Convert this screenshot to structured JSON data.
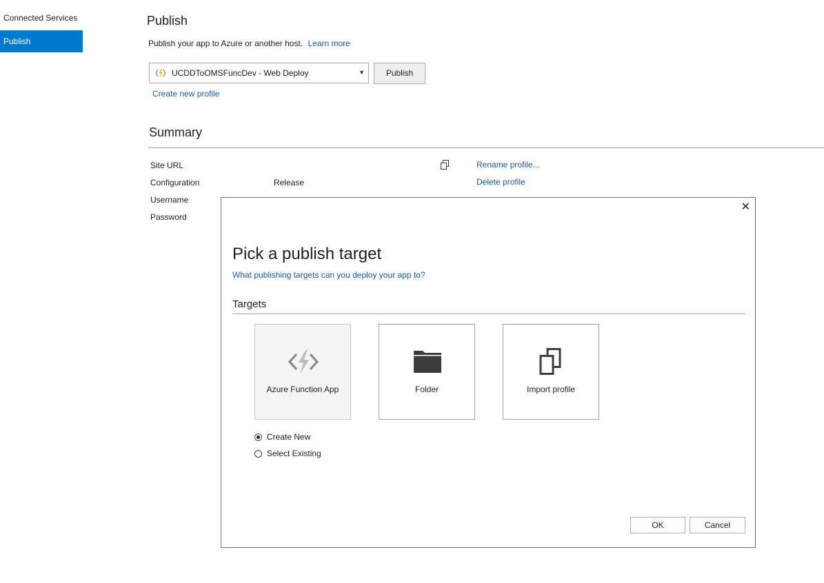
{
  "nav": {
    "items": [
      {
        "label": "Connected Services"
      },
      {
        "label": "Publish"
      }
    ]
  },
  "header": {
    "title": "Publish",
    "description": "Publish your app to Azure or another host.",
    "learn_more": "Learn more"
  },
  "profile": {
    "selected": "UCDDToOMSFuncDev - Web Deploy",
    "publish_button": "Publish",
    "create_new": "Create new profile",
    "icon": "azure-function-icon"
  },
  "summary": {
    "title": "Summary",
    "rows": [
      {
        "label": "Site URL",
        "value": ""
      },
      {
        "label": "Configuration",
        "value": "Release"
      },
      {
        "label": "Username",
        "value": ""
      },
      {
        "label": "Password",
        "value": ""
      }
    ],
    "copy_icon": "copy-icon",
    "rename": "Rename profile...",
    "delete": "Delete profile"
  },
  "dialog": {
    "title": "Pick a publish target",
    "help_link": "What publishing targets can you deploy your app to?",
    "targets_heading": "Targets",
    "tiles": [
      {
        "label": "Azure Function App",
        "icon": "azure-function-icon",
        "selected": true
      },
      {
        "label": "Folder",
        "icon": "folder-icon",
        "selected": false
      },
      {
        "label": "Import profile",
        "icon": "import-profile-icon",
        "selected": false
      }
    ],
    "options": [
      {
        "label": "Create New",
        "checked": true
      },
      {
        "label": "Select Existing",
        "checked": false
      }
    ],
    "ok": "OK",
    "cancel": "Cancel",
    "close": "✕"
  },
  "colors": {
    "accent": "#007acc",
    "link": "#1a5aa6"
  }
}
